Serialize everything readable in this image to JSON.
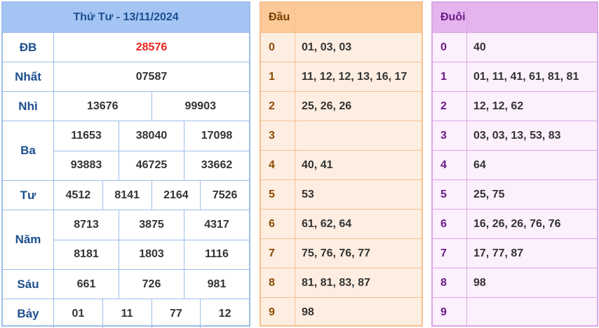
{
  "results": {
    "title": "Thứ Tư - 13/11/2024",
    "prizes": [
      {
        "label": "ĐB",
        "rows": [
          [
            "28576"
          ]
        ]
      },
      {
        "label": "Nhất",
        "rows": [
          [
            "07587"
          ]
        ]
      },
      {
        "label": "Nhì",
        "rows": [
          [
            "13676",
            "99903"
          ]
        ]
      },
      {
        "label": "Ba",
        "rows": [
          [
            "11653",
            "38040",
            "17098"
          ],
          [
            "93883",
            "46725",
            "33662"
          ]
        ]
      },
      {
        "label": "Tư",
        "rows": [
          [
            "4512",
            "8141",
            "2164",
            "7526"
          ]
        ]
      },
      {
        "label": "Năm",
        "rows": [
          [
            "8713",
            "3875",
            "4317"
          ],
          [
            "8181",
            "1803",
            "1116"
          ]
        ]
      },
      {
        "label": "Sáu",
        "rows": [
          [
            "661",
            "726",
            "981"
          ]
        ]
      },
      {
        "label": "Bảy",
        "rows": [
          [
            "01",
            "11",
            "77",
            "12"
          ]
        ]
      }
    ],
    "special_color": "#e8221b"
  },
  "dau": {
    "header": "Đầu",
    "rows": [
      {
        "key": "0",
        "value": "01, 03, 03"
      },
      {
        "key": "1",
        "value": "11, 12, 12, 13, 16, 17"
      },
      {
        "key": "2",
        "value": "25, 26, 26"
      },
      {
        "key": "3",
        "value": ""
      },
      {
        "key": "4",
        "value": "40, 41"
      },
      {
        "key": "5",
        "value": "53"
      },
      {
        "key": "6",
        "value": "61, 62, 64"
      },
      {
        "key": "7",
        "value": "75, 76, 76, 77"
      },
      {
        "key": "8",
        "value": "81, 81, 83, 87"
      },
      {
        "key": "9",
        "value": "98"
      }
    ]
  },
  "duoi": {
    "header": "Đuôi",
    "rows": [
      {
        "key": "0",
        "value": "40"
      },
      {
        "key": "1",
        "value": "01, 11, 41, 61, 81, 81"
      },
      {
        "key": "2",
        "value": "12, 12, 62"
      },
      {
        "key": "3",
        "value": "03, 03, 13, 53, 83"
      },
      {
        "key": "4",
        "value": "64"
      },
      {
        "key": "5",
        "value": "25, 75"
      },
      {
        "key": "6",
        "value": "16, 26, 26, 76, 76"
      },
      {
        "key": "7",
        "value": "17, 77, 87"
      },
      {
        "key": "8",
        "value": "98"
      },
      {
        "key": "9",
        "value": ""
      }
    ]
  }
}
